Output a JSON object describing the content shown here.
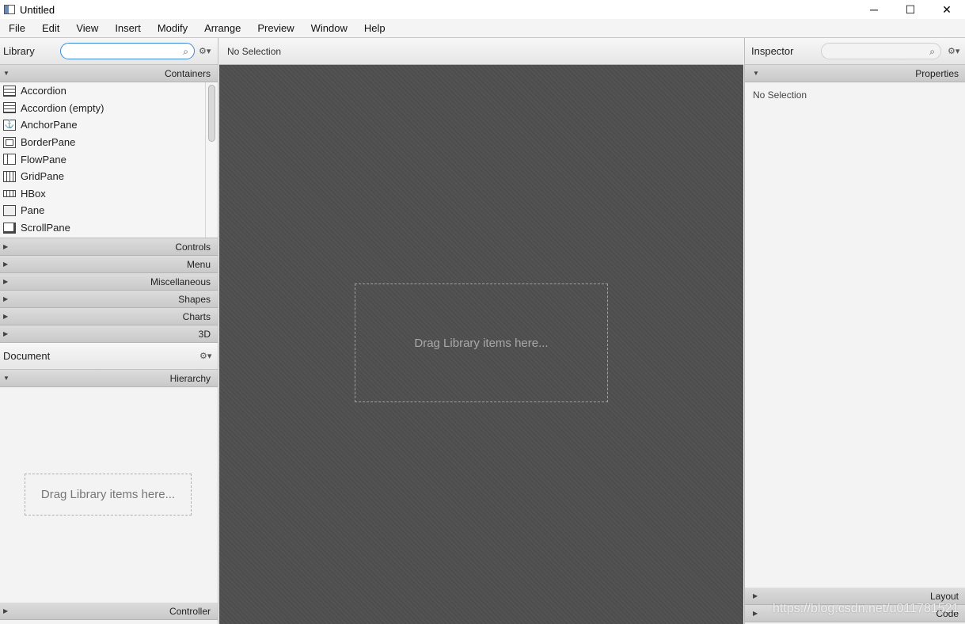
{
  "window": {
    "title": "Untitled",
    "controls": [
      "─",
      "☐",
      "✕"
    ]
  },
  "menu": [
    "File",
    "Edit",
    "View",
    "Insert",
    "Modify",
    "Arrange",
    "Preview",
    "Window",
    "Help"
  ],
  "library": {
    "title": "Library",
    "search_value": "",
    "open_section": "Containers",
    "items": [
      "Accordion",
      "Accordion  (empty)",
      "AnchorPane",
      "BorderPane",
      "FlowPane",
      "GridPane",
      "HBox",
      "Pane",
      "ScrollPane"
    ],
    "sections": [
      "Controls",
      "Menu",
      "Miscellaneous",
      "Shapes",
      "Charts",
      "3D"
    ]
  },
  "document": {
    "title": "Document",
    "hierarchy_label": "Hierarchy",
    "drop_hint": "Drag Library items here...",
    "controller_label": "Controller"
  },
  "center": {
    "selection": "No Selection",
    "drop_hint": "Drag Library items here..."
  },
  "inspector": {
    "title": "Inspector",
    "search_value": "",
    "properties_label": "Properties",
    "selection": "No Selection",
    "layout_label": "Layout",
    "code_label": "Code"
  },
  "watermark": "https://blog.csdn.net/u011781521"
}
